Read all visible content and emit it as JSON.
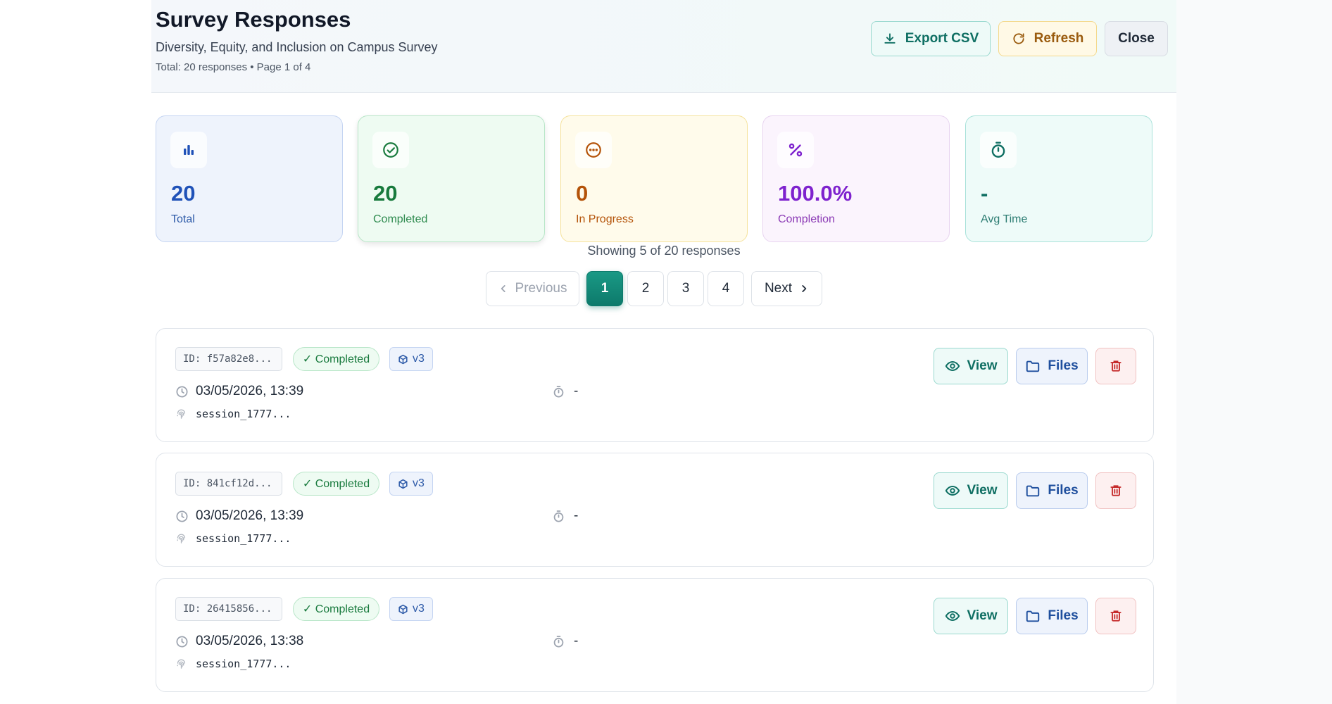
{
  "header": {
    "title": "Survey Responses",
    "subtitle": "Diversity, Equity, and Inclusion on Campus Survey",
    "meta": "Total: 20 responses • Page 1 of 4",
    "export_label": "Export CSV",
    "refresh_label": "Refresh",
    "close_label": "Close"
  },
  "stats": [
    {
      "value": "20",
      "label": "Total",
      "icon": "bar-chart-icon"
    },
    {
      "value": "20",
      "label": "Completed",
      "icon": "check-circle-icon"
    },
    {
      "value": "0",
      "label": "In Progress",
      "icon": "ellipsis-circle-icon"
    },
    {
      "value": "100.0%",
      "label": "Completion",
      "icon": "percent-icon"
    },
    {
      "value": "-",
      "label": "Avg Time",
      "icon": "stopwatch-icon"
    }
  ],
  "pagination": {
    "showing": "Showing 5 of 20 responses",
    "previous": "Previous",
    "next": "Next",
    "pages": [
      "1",
      "2",
      "3",
      "4"
    ],
    "current": "1"
  },
  "responses": [
    {
      "id": "ID: f57a82e8...",
      "status": "✓ Completed",
      "version": "v3",
      "date": "03/05/2026, 13:39",
      "duration": "-",
      "session": "session_1777..."
    },
    {
      "id": "ID: 841cf12d...",
      "status": "✓ Completed",
      "version": "v3",
      "date": "03/05/2026, 13:39",
      "duration": "-",
      "session": "session_1777..."
    },
    {
      "id": "ID: 26415856...",
      "status": "✓ Completed",
      "version": "v3",
      "date": "03/05/2026, 13:38",
      "duration": "-",
      "session": "session_1777..."
    }
  ],
  "actions": {
    "view": "View",
    "files": "Files"
  },
  "colors": {
    "accent": "#0d7a6b",
    "primary_blue": "#2052b8",
    "danger": "#c52a2a"
  }
}
